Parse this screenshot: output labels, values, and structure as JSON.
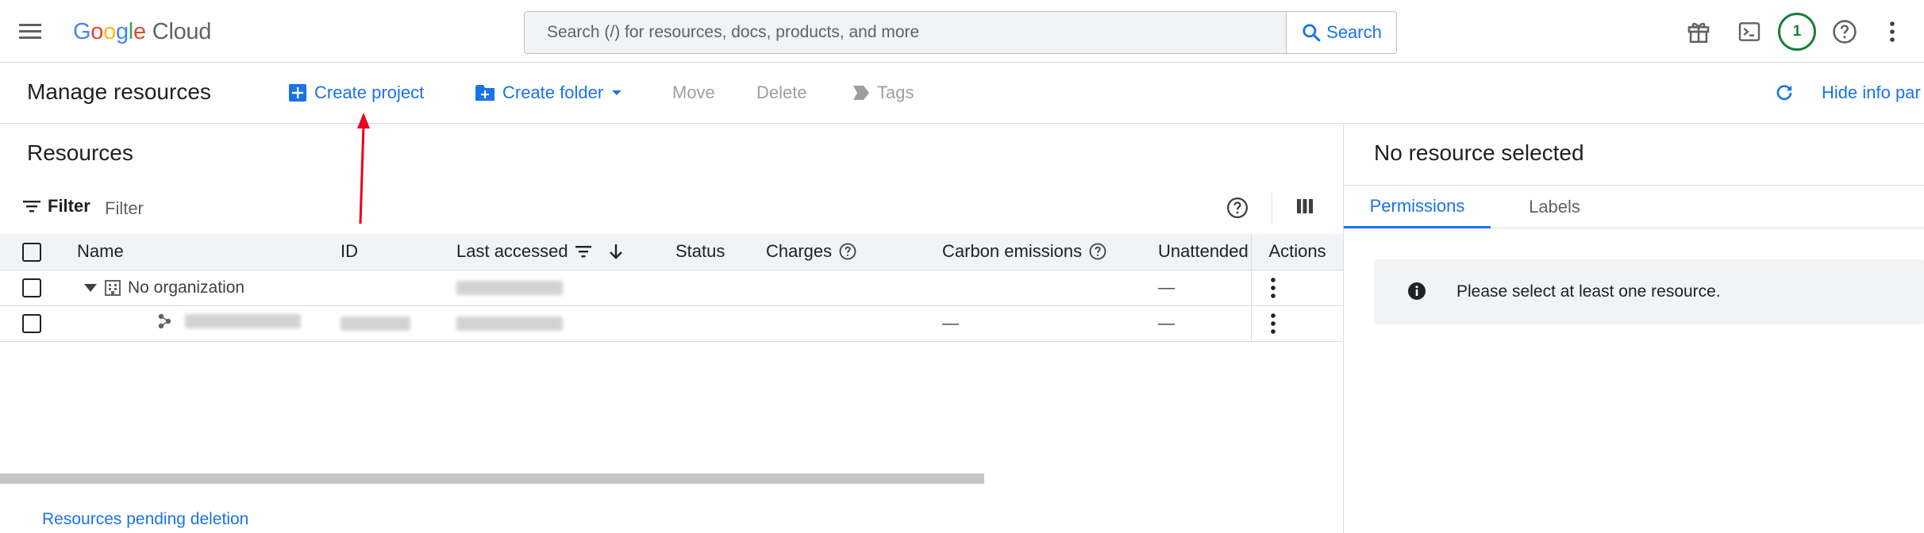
{
  "header": {
    "logo": {
      "letters": [
        "G",
        "o",
        "o",
        "g",
        "l",
        "e"
      ],
      "product": "Cloud"
    },
    "search": {
      "placeholder": "Search (/) for resources, docs, products, and more",
      "button_label": "Search"
    },
    "notification_count": "1",
    "icons": [
      "menu-icon",
      "search-icon",
      "gift-icon",
      "terminal-icon",
      "help-icon",
      "more-vert-icon"
    ]
  },
  "toolbar": {
    "page_title": "Manage resources",
    "create_project": "Create project",
    "create_folder": "Create folder",
    "move": "Move",
    "delete": "Delete",
    "tags": "Tags",
    "hide_info_panel": "Hide info par"
  },
  "resources": {
    "title": "Resources",
    "filter_label": "Filter",
    "filter_placeholder": "Filter",
    "columns": {
      "name": "Name",
      "id": "ID",
      "last_accessed": "Last accessed",
      "status": "Status",
      "charges": "Charges",
      "carbon": "Carbon emissions",
      "unattended": "Unattended",
      "actions": "Actions"
    },
    "rows": [
      {
        "name": "No organization",
        "id": "",
        "carbon": "",
        "unattended": "—"
      },
      {
        "name": "",
        "id": "",
        "carbon": "—",
        "unattended": "—"
      }
    ],
    "pending_deletion": "Resources pending deletion"
  },
  "info_panel": {
    "title": "No resource selected",
    "tabs": [
      "Permissions",
      "Labels"
    ],
    "active_tab": "Permissions",
    "message": "Please select at least one resource."
  },
  "colors": {
    "accent": "#1a73e8",
    "disabled": "#9aa0a6",
    "notification": "#188038",
    "annotation_arrow": "#e8001c"
  }
}
